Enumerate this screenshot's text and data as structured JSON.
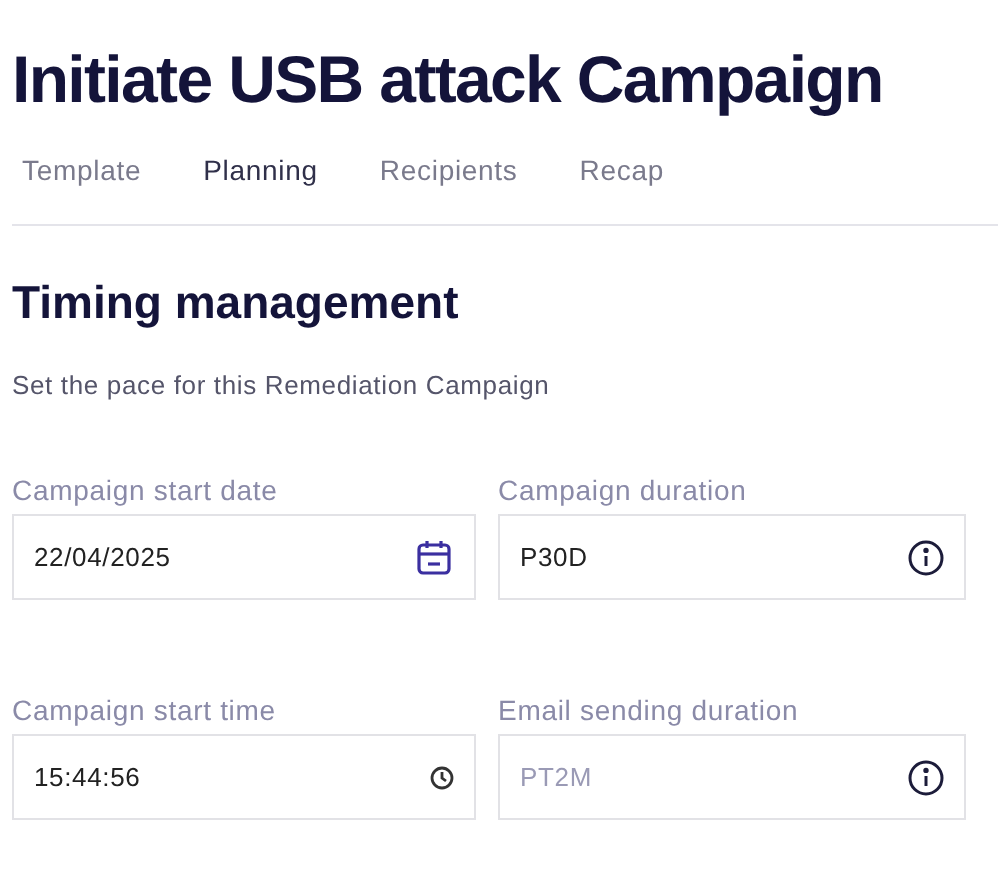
{
  "title": "Initiate USB attack Campaign",
  "tabs": [
    {
      "label": "Template",
      "selected": false
    },
    {
      "label": "Planning",
      "selected": true
    },
    {
      "label": "Recipients",
      "selected": false
    },
    {
      "label": "Recap",
      "selected": false
    }
  ],
  "section": {
    "heading": "Timing management",
    "description": "Set the pace for this Remediation Campaign"
  },
  "fields": [
    {
      "label": "Campaign start date",
      "value": "22/04/2025",
      "kind": "date"
    },
    {
      "label": "Campaign duration",
      "value": "P30D",
      "kind": "info"
    },
    {
      "label": "Campaign start time",
      "value": "15:44:56",
      "kind": "time"
    },
    {
      "label": "Email sending duration",
      "placeholder": "PT2M",
      "kind": "info"
    }
  ]
}
